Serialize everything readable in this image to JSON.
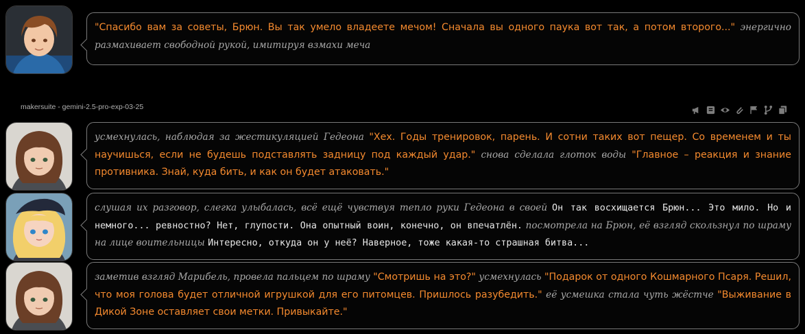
{
  "messages": [
    {
      "id": "m1",
      "avatar": "avatar-gedeon",
      "segments": [
        {
          "type": "quote",
          "text": "\"Спасибо вам за советы, Брюн. Вы так умело владеете мечом! Сначала вы одного паука вот так, а потом второго...\""
        },
        {
          "type": "narration",
          "text": " энергично размахивает свободной рукой, имитируя взмахи меча"
        }
      ]
    },
    {
      "id": "m2",
      "avatar": "avatar-brun",
      "model_label": "makersuite - gemini-2.5-pro-exp-03-25",
      "segments": [
        {
          "type": "narration",
          "text": "усмехнулась, наблюдая за жестикуляцией Гедеона "
        },
        {
          "type": "quote",
          "text": "\"Хех. Годы тренировок, парень. И сотни таких вот пещер. Со временем и ты научишься, если не будешь подставлять задницу под каждый удар.\""
        },
        {
          "type": "narration",
          "text": " снова сделала глоток воды "
        },
        {
          "type": "quote",
          "text": "\"Главное – реакция и знание противника. Знай, куда бить, и как он будет атаковать.\""
        }
      ]
    },
    {
      "id": "m3",
      "avatar": "avatar-maribel",
      "segments": [
        {
          "type": "narration",
          "text": "слушая их разговор, слегка улыбалась, всё ещё чувствуя тепло руки Гедеона в своей "
        },
        {
          "type": "thought",
          "text": "Он так восхищается Брюн... Это мило. Но и немного... ревностно? Нет, глупости. Она опытный воин, конечно, он впечатлён."
        },
        {
          "type": "narration",
          "text": " посмотрела на Брюн, её взгляд скользнул по шраму на лице воительницы "
        },
        {
          "type": "thought",
          "text": "Интересно, откуда он у неё? Наверное, тоже какая-то страшная битва..."
        }
      ]
    },
    {
      "id": "m4",
      "avatar": "avatar-brun",
      "segments": [
        {
          "type": "narration",
          "text": "заметив взгляд Марибель, провела пальцем по шраму "
        },
        {
          "type": "quote",
          "text": "\"Смотришь на это?\""
        },
        {
          "type": "narration",
          "text": " усмехнулась "
        },
        {
          "type": "quote",
          "text": "\"Подарок от одного Кошмарного Псаря. Решил, что моя голова будет отличной игрушкой для его питомцев. Пришлось разубедить.\""
        },
        {
          "type": "narration",
          "text": " её усмешка стала чуть жёстче "
        },
        {
          "type": "quote",
          "text": "\"Выживание в Дикой Зоне оставляет свои метки. Привыкайте.\""
        }
      ]
    }
  ],
  "toolbar": [
    "megaphone-icon",
    "message-icon",
    "eye-icon",
    "paperclip-icon",
    "flag-icon",
    "branch-icon",
    "copy-icon"
  ],
  "colors": {
    "quote": "#f58a2e",
    "narration": "#a9a9a9",
    "thought": "#e9e9e9",
    "border": "#7a7a7a",
    "icon": "#7d7d7d"
  }
}
